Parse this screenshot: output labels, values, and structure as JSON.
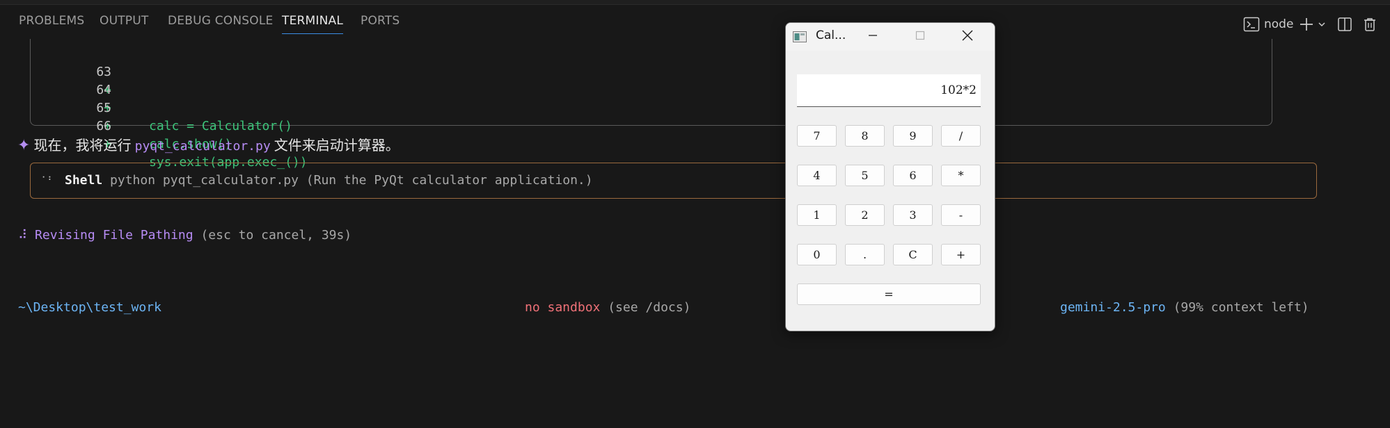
{
  "panel": {
    "tabs": [
      {
        "label": "PROBLEMS"
      },
      {
        "label": "OUTPUT"
      },
      {
        "label": "DEBUG CONSOLE"
      },
      {
        "label": "TERMINAL"
      },
      {
        "label": "PORTS"
      }
    ],
    "active_tab": "TERMINAL",
    "terminal_name": "node",
    "icons": [
      "terminal-icon",
      "plus-icon",
      "chevron-down-icon",
      "split-editor-icon",
      "trash-icon"
    ],
    "accent_color": "#3c8ee6"
  },
  "terminal": {
    "code_lines": [
      {
        "num": "63",
        "sign": "+",
        "code": ""
      },
      {
        "num": "64",
        "sign": "+",
        "code": "calc = Calculator()"
      },
      {
        "num": "65",
        "sign": "+",
        "code": "calc.show()"
      },
      {
        "num": "66",
        "sign": "+",
        "code": "sys.exit(app.exec_())"
      }
    ],
    "message": {
      "star": "✦",
      "prefix": "现在，我将运行",
      "filename": "pyqt_calculator.py",
      "suffix": "文件来启动计算器。"
    },
    "shell": {
      "label": "Shell",
      "command": "python pyqt_calculator.py (Run the PyQt calculator application.)"
    },
    "thinking": {
      "spinner": "⠼",
      "label": "Revising File Pathing",
      "hint": "(esc to cancel, 39s)"
    },
    "footer": {
      "path": "~\\Desktop\\test_work",
      "sandbox": "no sandbox",
      "sandbox_hint": "(see /docs)",
      "model": "gemini-2.5-pro",
      "context": "(99% context left)"
    }
  },
  "calculator": {
    "title": "Cal...",
    "display": "102*2",
    "keys": [
      [
        "7",
        "8",
        "9",
        "/"
      ],
      [
        "4",
        "5",
        "6",
        "*"
      ],
      [
        "1",
        "2",
        "3",
        "-"
      ],
      [
        "0",
        ".",
        "C",
        "+"
      ]
    ],
    "equals": "="
  }
}
